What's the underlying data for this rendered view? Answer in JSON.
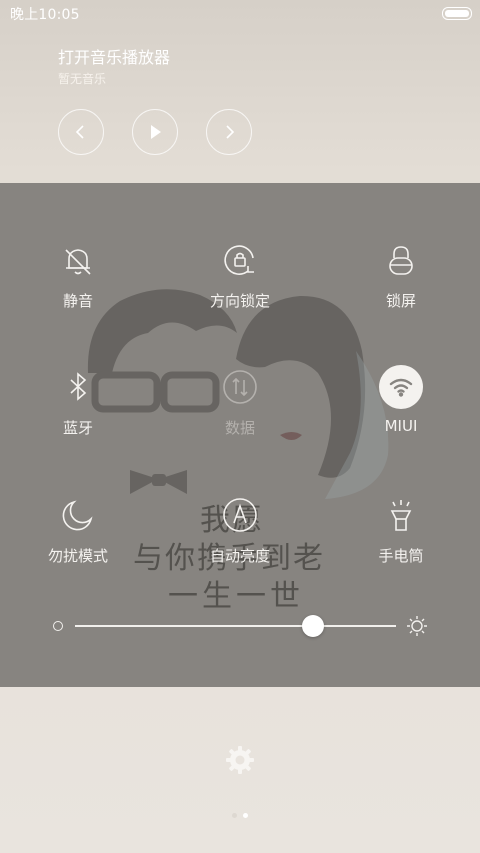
{
  "status_bar": {
    "time": "晚上10:05",
    "battery_level": 1.0
  },
  "music": {
    "title": "打开音乐播放器",
    "subtitle": "暂无音乐",
    "controls": [
      {
        "name": "previous",
        "icon": "chevron-left-icon"
      },
      {
        "name": "play",
        "icon": "play-icon"
      },
      {
        "name": "next",
        "icon": "chevron-right-icon"
      }
    ]
  },
  "toggles": [
    {
      "label": "静音",
      "icon": "bell-off-icon",
      "active": false,
      "enabled": true
    },
    {
      "label": "方向锁定",
      "icon": "rotation-lock-icon",
      "active": false,
      "enabled": true
    },
    {
      "label": "锁屏",
      "icon": "lock-icon",
      "active": false,
      "enabled": true
    },
    {
      "label": "蓝牙",
      "icon": "bluetooth-icon",
      "active": false,
      "enabled": true
    },
    {
      "label": "数据",
      "icon": "mobile-data-icon",
      "active": false,
      "enabled": false
    },
    {
      "label": "MIUI",
      "icon": "wifi-icon",
      "active": true,
      "enabled": true
    },
    {
      "label": "勿扰模式",
      "icon": "moon-icon",
      "active": false,
      "enabled": true
    },
    {
      "label": "自动亮度",
      "icon": "auto-brightness-icon",
      "active": false,
      "enabled": true
    },
    {
      "label": "手电筒",
      "icon": "flashlight-icon",
      "active": false,
      "enabled": true
    }
  ],
  "brightness": {
    "value": 0.74
  },
  "wallpaper": {
    "calligraphy": [
      "我愿",
      "与你携手到老",
      "一生一世"
    ]
  },
  "pager": {
    "count": 2,
    "current": 1
  },
  "colors": {
    "panel": "#878480",
    "icon": "#f4f2ef",
    "active_icon_bg": "#f4f2ef",
    "active_icon_fg": "#878480"
  }
}
